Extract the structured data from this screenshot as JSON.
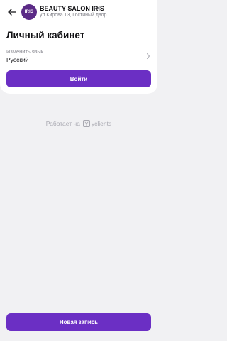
{
  "header": {
    "salon_name": "BEAUTY SALON IRIS",
    "salon_address": "ул.Кирова 13, Гостиный двор",
    "logo_text": "IRIS",
    "back_icon": "arrow-left-icon",
    "dropdown_icon": "chevron-down-icon"
  },
  "account": {
    "title": "Личный кабинет",
    "language_caption": "Изменить язык",
    "language_value": "Русский",
    "language_icon": "chevron-right-icon",
    "login_label": "Войти"
  },
  "footer": {
    "powered_prefix": "Работает на",
    "powered_brand": "yclients",
    "new_booking_label": "Новая запись"
  },
  "colors": {
    "accent": "#6b2fc4",
    "logo_bg": "#5b2a86",
    "background": "#f1f1f3",
    "card": "#ffffff"
  }
}
